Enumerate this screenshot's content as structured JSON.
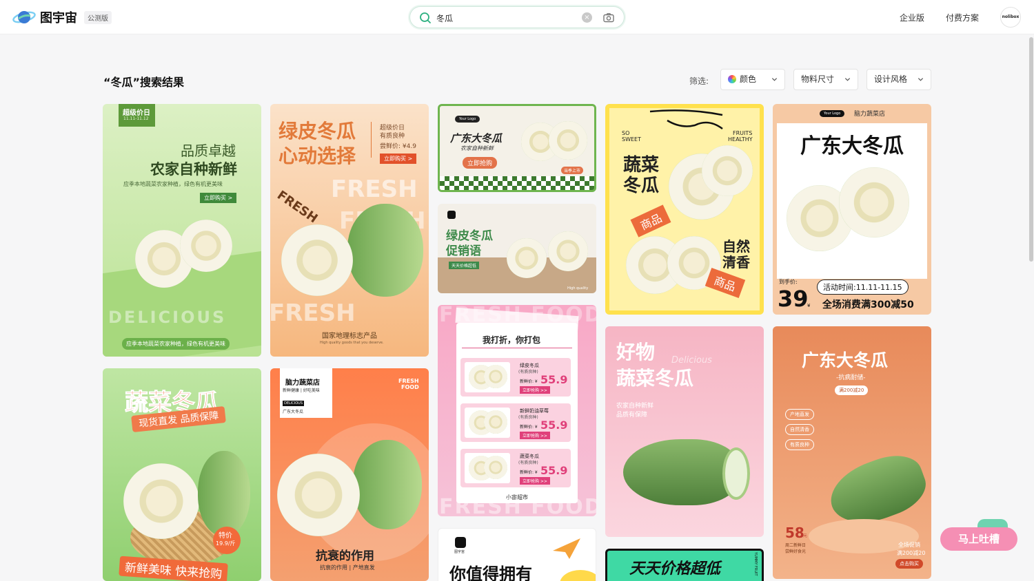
{
  "header": {
    "logo_text": "图宇宙",
    "beta_badge": "公测版",
    "search_value": "冬瓜",
    "clear_label": "×",
    "nav": [
      "企业版",
      "付费方案"
    ],
    "avatar_text": "nolibox"
  },
  "toolbar": {
    "result_title": "“冬瓜”搜索结果",
    "filter_label": "筛选:",
    "filters": [
      "颜色",
      "物料尺寸",
      "设计风格"
    ]
  },
  "cards": {
    "c1": {
      "badge_main": "超级价日",
      "badge_date": "11.11-11.12",
      "line1": "品质卓越",
      "line2": "农家自种新鲜",
      "desc": "应季本地蔬菜农家种植，绿色有机更美味",
      "btn": "立即购买 >",
      "bg_word": "DELICIOUS",
      "bottom": "应季本地蔬菜农家种植，绿色有机更美味"
    },
    "c2": {
      "title1": "绿皮冬瓜",
      "title2": "心动选择",
      "side1": "超级价日",
      "side2": "有质良种",
      "side3": "尝鲜价: ¥4.9",
      "btn": "立即购买 >",
      "fresh1": "FRESH",
      "fresh2": "FRESH",
      "fresh3": "FRESH",
      "fresh_tilt": "FRESH",
      "bottom1": "国家地理标志产品",
      "bottom2": "High quality goods that you deserve."
    },
    "c3": {
      "logo": "Your Logo",
      "title": "广东大冬瓜",
      "sub": "农家自种新鲜",
      "btn": "立即抢购",
      "tag": "当季上市"
    },
    "c4": {
      "title1": "绿皮冬瓜",
      "title2": "促销语",
      "tag": "天天价格超低",
      "foot": "High quality"
    },
    "c5": {
      "so": "SO",
      "sweet": "SWEET",
      "fruits": "FRUITS",
      "healthy": "HEALTHY",
      "t1": "蔬菜",
      "t2": "冬瓜",
      "tag1": "商品",
      "t3": "自然",
      "t4": "清香",
      "tag2": "商品"
    },
    "c6": {
      "logo": "Your Logo",
      "store": "脑力蔬菜店",
      "title": "广东大冬瓜",
      "price_label": "到手价:",
      "price": "39",
      "unit": "¥",
      "time": "活动时间:11.11-11.15",
      "promo": "全场消费满300减50"
    },
    "c7": {
      "bg_top": "FRESH FOOD",
      "title": "我打折，你打包",
      "items": [
        {
          "name": "绿皮冬瓜",
          "sub": "(有质良种)",
          "label": "新鲜价: ¥",
          "price": "55.9",
          "btn": "立即抢购 >>"
        },
        {
          "name": "新鲜奶油草莓",
          "sub": "(有质良种)",
          "label": "新鲜价: ¥",
          "price": "55.9",
          "btn": "立即抢购 >>"
        },
        {
          "name": "蔬菜冬瓜",
          "sub": "(有质良种)",
          "label": "新鲜价: ¥",
          "price": "55.9",
          "btn": "立即抢购 >>"
        }
      ],
      "store": "小宙超市",
      "bg_bottom": "FRESH FOOD"
    },
    "c8": {
      "t1": "好物",
      "t2": "蔬菜冬瓜",
      "script": "Delicious",
      "sub1": "农家自种新鲜",
      "sub2": "品质有保障"
    },
    "c9": {
      "title": "广东大冬瓜",
      "sub": "-抗病耐储-",
      "badge": "满200减20",
      "tags": [
        "产地直发",
        "自然清香",
        "有质良种"
      ],
      "price": "58",
      "price_unit": "元",
      "note1": "周二新鲜日",
      "note2": "尝鲜好食光",
      "r1": "全场促销",
      "r2": "满200减20",
      "r_btn": "点击购买"
    },
    "c10": {
      "t1": "蔬菜冬瓜",
      "t2": "现货直发 品质保障",
      "badge1": "特价",
      "badge2": "19.9/斤",
      "bottom": "新鲜美味  快来抢购"
    },
    "c11": {
      "store": "脑力蔬菜店",
      "tagline": "新鲜健康 | 好吃美味",
      "tag": "DELICIOUS",
      "name": "广东大冬瓜",
      "fresh1": "FRESH",
      "fresh2": "FOOD",
      "title": "抗衰的作用",
      "sub": "抗衰的作用 | 产地直发"
    },
    "c12": {
      "logo_sub": "图宇宙",
      "title": "你值得拥有"
    },
    "c13": {
      "title": "天天价格超低",
      "side": "YUMMY FRUIT"
    }
  },
  "feedback": "马上吐槽",
  "colors": {
    "accent": "#2bb07f",
    "brand_blue": "#3a7bd5"
  }
}
